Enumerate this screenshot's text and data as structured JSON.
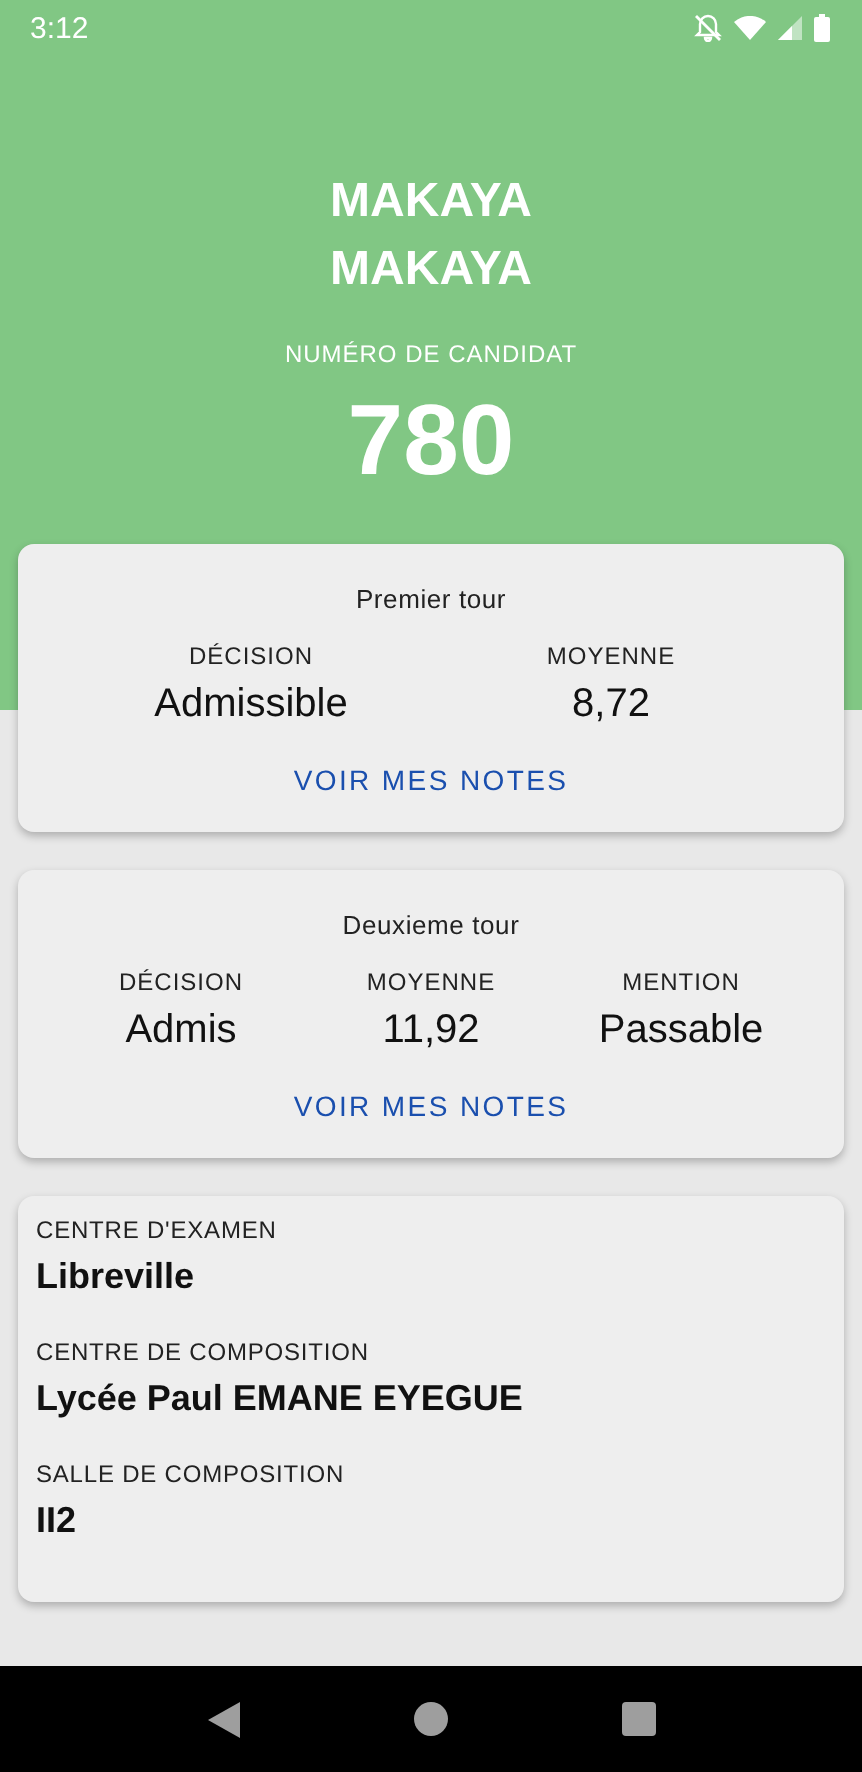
{
  "status_bar": {
    "time": "3:12"
  },
  "candidate": {
    "name_lines": [
      "MAKAYA",
      "MAKAYA"
    ],
    "number_label": "NUMÉRO DE CANDIDAT",
    "number": "780"
  },
  "rounds": [
    {
      "title": "Premier tour",
      "columns": [
        {
          "label": "DÉCISION",
          "value": "Admissible"
        },
        {
          "label": "MOYENNE",
          "value": "8,72"
        }
      ],
      "button": "VOIR MES NOTES"
    },
    {
      "title": "Deuxieme tour",
      "columns": [
        {
          "label": "DÉCISION",
          "value": "Admis"
        },
        {
          "label": "MOYENNE",
          "value": "11,92"
        },
        {
          "label": "MENTION",
          "value": "Passable"
        }
      ],
      "button": "VOIR MES NOTES"
    }
  ],
  "exam_info": [
    {
      "label": "CENTRE D'EXAMEN",
      "value": "Libreville"
    },
    {
      "label": "CENTRE DE COMPOSITION",
      "value": "Lycée Paul EMANE EYEGUE"
    },
    {
      "label": "SALLE DE COMPOSITION",
      "value": "II2"
    }
  ]
}
